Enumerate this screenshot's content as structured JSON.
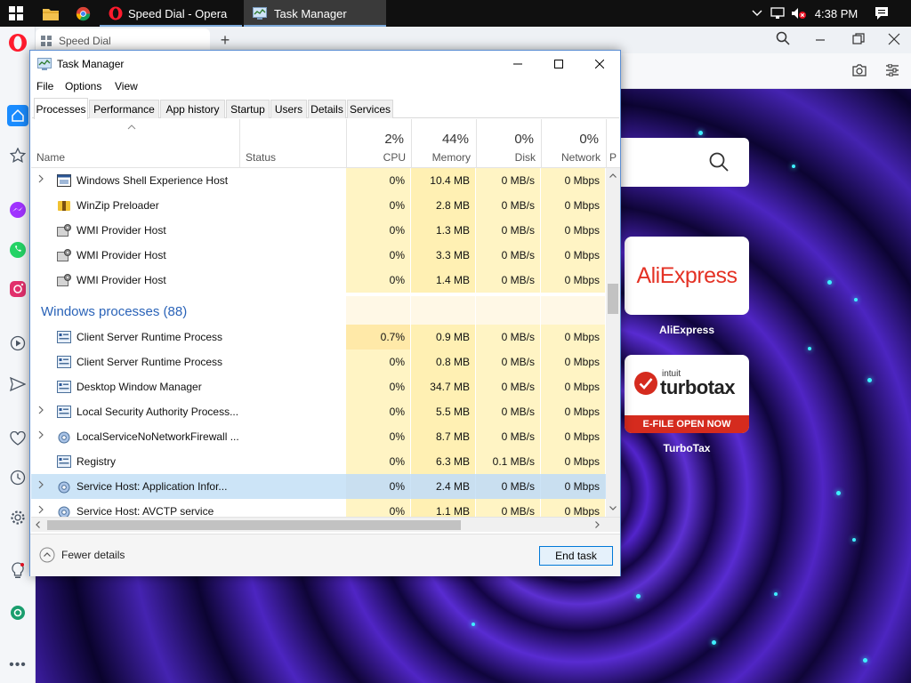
{
  "taskbar": {
    "tasks": [
      {
        "label": "Speed Dial - Opera"
      },
      {
        "label": "Task Manager"
      }
    ],
    "clock": "4:38 PM"
  },
  "opera": {
    "tab_label": "Speed Dial",
    "tiles": [
      {
        "brand": "AliExpress",
        "label": "AliExpress",
        "brand_color": "#e43225"
      },
      {
        "brand_small": "intuit",
        "brand": "turbotax",
        "banner": "E-FILE OPEN NOW",
        "label": "TurboTax",
        "brand_color": "#d52b1e"
      }
    ]
  },
  "task_manager": {
    "title": "Task Manager",
    "menu": [
      "File",
      "Options",
      "View"
    ],
    "tabs": [
      "Processes",
      "Performance",
      "App history",
      "Startup",
      "Users",
      "Details",
      "Services"
    ],
    "columns": {
      "name": "Name",
      "status": "Status",
      "cpu": {
        "pct": "2%",
        "label": "CPU"
      },
      "memory": {
        "pct": "44%",
        "label": "Memory"
      },
      "disk": {
        "pct": "0%",
        "label": "Disk"
      },
      "network": {
        "pct": "0%",
        "label": "Network"
      },
      "power": "P"
    },
    "rows": [
      {
        "type": "process",
        "expand": true,
        "name": "Windows Shell Experience Host",
        "cpu": "0%",
        "memory": "10.4 MB",
        "disk": "0 MB/s",
        "network": "0 Mbps"
      },
      {
        "type": "process",
        "expand": false,
        "name": "WinZip Preloader",
        "cpu": "0%",
        "memory": "2.8 MB",
        "disk": "0 MB/s",
        "network": "0 Mbps"
      },
      {
        "type": "process",
        "expand": false,
        "name": "WMI Provider Host",
        "cpu": "0%",
        "memory": "1.3 MB",
        "disk": "0 MB/s",
        "network": "0 Mbps"
      },
      {
        "type": "process",
        "expand": false,
        "name": "WMI Provider Host",
        "cpu": "0%",
        "memory": "3.3 MB",
        "disk": "0 MB/s",
        "network": "0 Mbps"
      },
      {
        "type": "process",
        "expand": false,
        "name": "WMI Provider Host",
        "cpu": "0%",
        "memory": "1.4 MB",
        "disk": "0 MB/s",
        "network": "0 Mbps"
      },
      {
        "type": "group",
        "name": "Windows processes (88)"
      },
      {
        "type": "process",
        "expand": false,
        "name": "Client Server Runtime Process",
        "cpu": "0.7%",
        "memory": "0.9 MB",
        "disk": "0 MB/s",
        "network": "0 Mbps"
      },
      {
        "type": "process",
        "expand": false,
        "name": "Client Server Runtime Process",
        "cpu": "0%",
        "memory": "0.8 MB",
        "disk": "0 MB/s",
        "network": "0 Mbps"
      },
      {
        "type": "process",
        "expand": false,
        "name": "Desktop Window Manager",
        "cpu": "0%",
        "memory": "34.7 MB",
        "disk": "0 MB/s",
        "network": "0 Mbps"
      },
      {
        "type": "process",
        "expand": true,
        "name": "Local Security Authority Process...",
        "cpu": "0%",
        "memory": "5.5 MB",
        "disk": "0 MB/s",
        "network": "0 Mbps"
      },
      {
        "type": "process",
        "expand": true,
        "name": "LocalServiceNoNetworkFirewall ...",
        "cpu": "0%",
        "memory": "8.7 MB",
        "disk": "0 MB/s",
        "network": "0 Mbps"
      },
      {
        "type": "process",
        "expand": false,
        "name": "Registry",
        "cpu": "0%",
        "memory": "6.3 MB",
        "disk": "0.1 MB/s",
        "network": "0 Mbps"
      },
      {
        "type": "process",
        "expand": true,
        "selected": true,
        "name": "Service Host: Application Infor...",
        "cpu": "0%",
        "memory": "2.4 MB",
        "disk": "0 MB/s",
        "network": "0 Mbps"
      },
      {
        "type": "process",
        "expand": true,
        "name": "Service Host: AVCTP service",
        "cpu": "0%",
        "memory": "1.1 MB",
        "disk": "0 MB/s",
        "network": "0 Mbps"
      }
    ],
    "footer": {
      "fewer_details": "Fewer details",
      "end_task": "End task"
    }
  }
}
